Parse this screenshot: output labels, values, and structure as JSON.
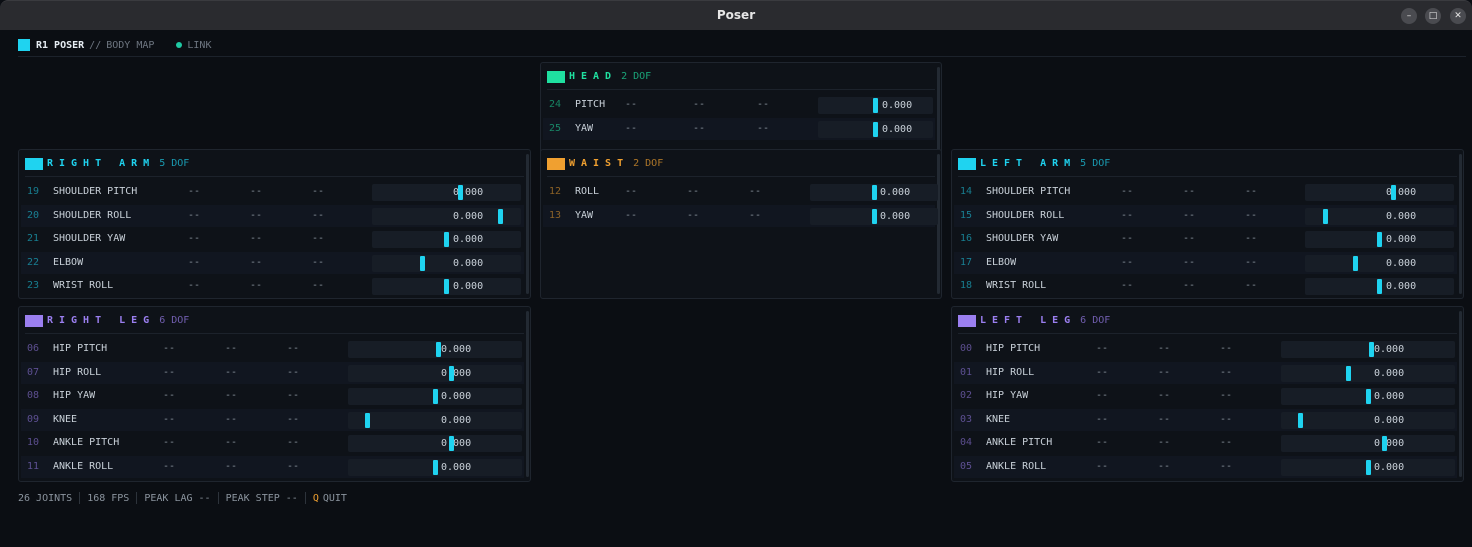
{
  "window": {
    "title": "Poser",
    "minimize": "–",
    "maximize": "□",
    "close": "✕"
  },
  "topbar": {
    "app": "R1 POSER",
    "sep": "//",
    "mode": "BODY MAP",
    "link": "LINK"
  },
  "colors": {
    "accent": "#1fd3f0",
    "head": "#1fe0a0",
    "arm": "#1fd3f0",
    "waist": "#f0a030",
    "leg": "#9b7ff0",
    "link": "#1fc9a3"
  },
  "panels": {
    "head": {
      "name": "HEAD",
      "dof": "2 DOF",
      "joints": [
        {
          "idx": "24",
          "name": "PITCH",
          "c1": "--",
          "c2": "--",
          "c3": "--",
          "value": "0.000",
          "pos": 0.5
        },
        {
          "idx": "25",
          "name": "YAW",
          "c1": "--",
          "c2": "--",
          "c3": "--",
          "value": "0.000",
          "pos": 0.5
        }
      ]
    },
    "right_arm": {
      "name": "RIGHT ARM",
      "dof": "5 DOF",
      "joints": [
        {
          "idx": "19",
          "name": "SHOULDER PITCH",
          "c1": "--",
          "c2": "--",
          "c3": "--",
          "value": "0.000",
          "pos": 0.6
        },
        {
          "idx": "20",
          "name": "SHOULDER ROLL",
          "c1": "--",
          "c2": "--",
          "c3": "--",
          "value": "0.000",
          "pos": 0.9
        },
        {
          "idx": "21",
          "name": "SHOULDER YAW",
          "c1": "--",
          "c2": "--",
          "c3": "--",
          "value": "0.000",
          "pos": 0.5
        },
        {
          "idx": "22",
          "name": "ELBOW",
          "c1": "--",
          "c2": "--",
          "c3": "--",
          "value": "0.000",
          "pos": 0.32
        },
        {
          "idx": "23",
          "name": "WRIST ROLL",
          "c1": "--",
          "c2": "--",
          "c3": "--",
          "value": "0.000",
          "pos": 0.5
        }
      ]
    },
    "waist": {
      "name": "WAIST",
      "dof": "2 DOF",
      "joints": [
        {
          "idx": "12",
          "name": "ROLL",
          "c1": "--",
          "c2": "--",
          "c3": "--",
          "value": "0.000",
          "pos": 0.5
        },
        {
          "idx": "13",
          "name": "YAW",
          "c1": "--",
          "c2": "--",
          "c3": "--",
          "value": "0.000",
          "pos": 0.5
        }
      ]
    },
    "left_arm": {
      "name": "LEFT ARM",
      "dof": "5 DOF",
      "joints": [
        {
          "idx": "14",
          "name": "SHOULDER PITCH",
          "c1": "--",
          "c2": "--",
          "c3": "--",
          "value": "0.000",
          "pos": 0.6
        },
        {
          "idx": "15",
          "name": "SHOULDER ROLL",
          "c1": "--",
          "c2": "--",
          "c3": "--",
          "value": "0.000",
          "pos": 0.1
        },
        {
          "idx": "16",
          "name": "SHOULDER YAW",
          "c1": "--",
          "c2": "--",
          "c3": "--",
          "value": "0.000",
          "pos": 0.5
        },
        {
          "idx": "17",
          "name": "ELBOW",
          "c1": "--",
          "c2": "--",
          "c3": "--",
          "value": "0.000",
          "pos": 0.32
        },
        {
          "idx": "18",
          "name": "WRIST ROLL",
          "c1": "--",
          "c2": "--",
          "c3": "--",
          "value": "0.000",
          "pos": 0.5
        }
      ]
    },
    "right_leg": {
      "name": "RIGHT LEG",
      "dof": "6 DOF",
      "joints": [
        {
          "idx": "06",
          "name": "HIP PITCH",
          "c1": "--",
          "c2": "--",
          "c3": "--",
          "value": "0.000",
          "pos": 0.52
        },
        {
          "idx": "07",
          "name": "HIP ROLL",
          "c1": "--",
          "c2": "--",
          "c3": "--",
          "value": "0.000",
          "pos": 0.6
        },
        {
          "idx": "08",
          "name": "HIP YAW",
          "c1": "--",
          "c2": "--",
          "c3": "--",
          "value": "0.000",
          "pos": 0.5
        },
        {
          "idx": "09",
          "name": "KNEE",
          "c1": "--",
          "c2": "--",
          "c3": "--",
          "value": "0.000",
          "pos": 0.08
        },
        {
          "idx": "10",
          "name": "ANKLE PITCH",
          "c1": "--",
          "c2": "--",
          "c3": "--",
          "value": "0.000",
          "pos": 0.6
        },
        {
          "idx": "11",
          "name": "ANKLE ROLL",
          "c1": "--",
          "c2": "--",
          "c3": "--",
          "value": "0.000",
          "pos": 0.5
        }
      ]
    },
    "left_leg": {
      "name": "LEFT LEG",
      "dof": "6 DOF",
      "joints": [
        {
          "idx": "00",
          "name": "HIP PITCH",
          "c1": "--",
          "c2": "--",
          "c3": "--",
          "value": "0.000",
          "pos": 0.52
        },
        {
          "idx": "01",
          "name": "HIP ROLL",
          "c1": "--",
          "c2": "--",
          "c3": "--",
          "value": "0.000",
          "pos": 0.38
        },
        {
          "idx": "02",
          "name": "HIP YAW",
          "c1": "--",
          "c2": "--",
          "c3": "--",
          "value": "0.000",
          "pos": 0.5
        },
        {
          "idx": "03",
          "name": "KNEE",
          "c1": "--",
          "c2": "--",
          "c3": "--",
          "value": "0.000",
          "pos": 0.08
        },
        {
          "idx": "04",
          "name": "ANKLE PITCH",
          "c1": "--",
          "c2": "--",
          "c3": "--",
          "value": "0.000",
          "pos": 0.6
        },
        {
          "idx": "05",
          "name": "ANKLE ROLL",
          "c1": "--",
          "c2": "--",
          "c3": "--",
          "value": "0.000",
          "pos": 0.5
        }
      ]
    }
  },
  "status": {
    "joints": "26 JOINTS",
    "fps": "168 FPS",
    "lag": "PEAK LAG --",
    "step": "PEAK STEP --",
    "quit_key": "Q",
    "quit": "QUIT"
  }
}
